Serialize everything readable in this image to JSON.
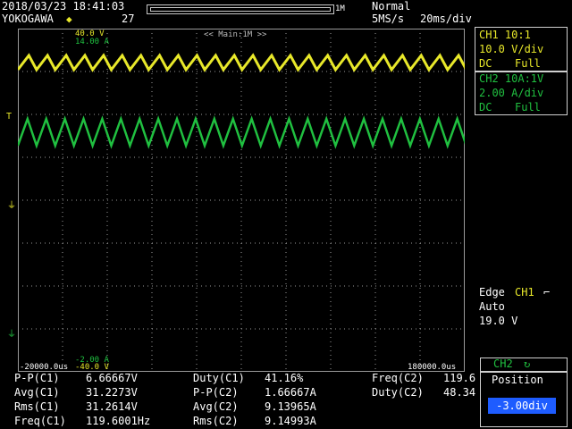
{
  "header": {
    "datetime": "2018/03/23 18:41:03",
    "brand": "YOKOGAWA",
    "acq_count": "27",
    "record_len": "1M",
    "trigger_mode": "Normal",
    "sample_rate": "5MS/s",
    "timebase": "20ms/div"
  },
  "ch1": {
    "title": "CH1 10:1",
    "scale": "10.0 V/div",
    "coupling": "DC",
    "bw": "Full"
  },
  "ch2": {
    "title": "CH2 10A:1V",
    "scale": "2.00 A/div",
    "coupling": "DC",
    "bw": "Full"
  },
  "plot": {
    "zoom_label": "<< Main:1M >>",
    "top_ch1": "40.0 V",
    "top_ch2": "14.00 A",
    "bottom_ch2": "-2.00 A",
    "bottom_ch1": "-40.0 V",
    "t_left": "-20000.0us",
    "t_right": "180000.0us",
    "colors": {
      "ch1": "#e8e82a",
      "ch2": "#20c040",
      "grid": "#9a9a9a"
    }
  },
  "trigger": {
    "type": "Edge",
    "source": "CH1",
    "mode": "Auto",
    "level": "19.0 V"
  },
  "position": {
    "header": "CH2",
    "label": "Position",
    "value": "-3.00div"
  },
  "measurements": {
    "col1": [
      {
        "label": "P-P(C1)",
        "value": "6.66667V"
      },
      {
        "label": "Avg(C1)",
        "value": "31.2273V"
      },
      {
        "label": "Rms(C1)",
        "value": "31.2614V"
      },
      {
        "label": "Freq(C1)",
        "value": "119.6001Hz"
      }
    ],
    "col2": [
      {
        "label": "Duty(C1)",
        "value": "41.16%"
      },
      {
        "label": "P-P(C2)",
        "value": "1.66667A"
      },
      {
        "label": "Avg(C2)",
        "value": "9.13965A"
      },
      {
        "label": "Rms(C2)",
        "value": "9.14993A"
      }
    ],
    "col3": [
      {
        "label": "Freq(C2)",
        "value": "119.6"
      },
      {
        "label": "Duty(C2)",
        "value": "48.34"
      }
    ]
  },
  "chart_data": {
    "type": "line",
    "x_unit": "us",
    "xlim": [
      -20000,
      180000
    ],
    "series": [
      {
        "name": "CH1",
        "frequency_hz": 119.6001,
        "peak_to_peak_v": 6.66667,
        "avg_v": 31.2273,
        "duty_pct": 41.16
      },
      {
        "name": "CH2",
        "frequency_hz": 119.6,
        "peak_to_peak_a": 1.66667,
        "avg_a": 9.13965,
        "duty_pct": 48.34
      }
    ]
  }
}
